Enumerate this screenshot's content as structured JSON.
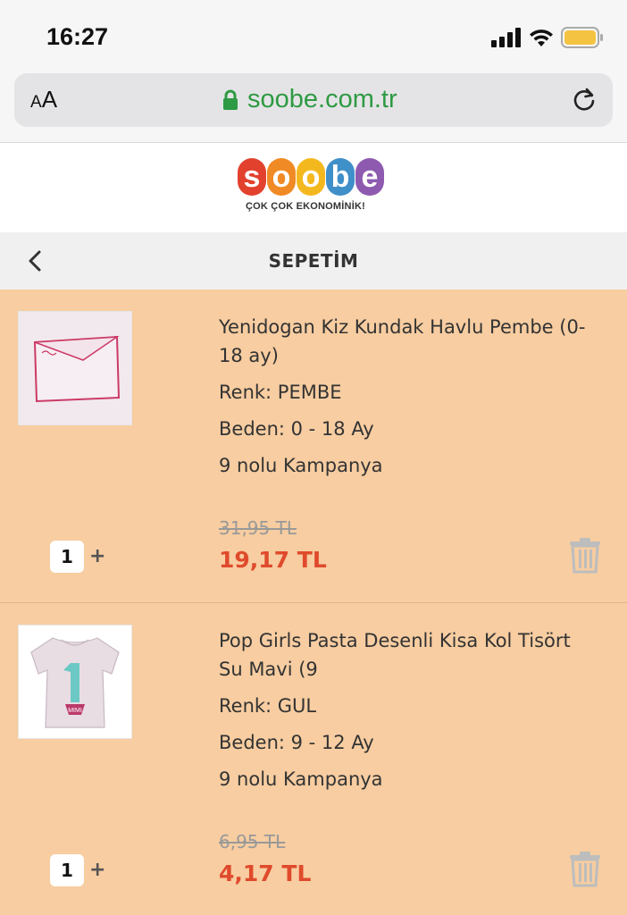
{
  "status_bar": {
    "time": "16:27"
  },
  "browser": {
    "text_size_label_small": "A",
    "text_size_label_large": "A",
    "url": "soobe.com.tr"
  },
  "logo": {
    "letters": [
      "s",
      "o",
      "o",
      "b",
      "e"
    ],
    "letter_colors": [
      "#e2412e",
      "#f08a24",
      "#f4b81f",
      "#3f8fc9",
      "#8e5ab0"
    ],
    "tagline": "ÇOK ÇOK EKONOMİNİK!"
  },
  "header": {
    "title": "SEPETİM"
  },
  "colors": {
    "cart_background": "#f7cda1",
    "price_red": "#e04a2c",
    "url_green": "#2e9a43"
  },
  "cart": {
    "items": [
      {
        "name": "Yenidogan Kiz Kundak Havlu Pembe (0-18 ay)",
        "color": "Renk: PEMBE",
        "size": "Beden: 0 - 18 Ay",
        "campaign": "9 nolu Kampanya",
        "old_price": "31,95 TL",
        "price": "19,17 TL",
        "quantity": "1",
        "plus": "+"
      },
      {
        "name": "Pop Girls Pasta Desenli Kisa Kol Tisört Su Mavi (9",
        "color": "Renk: GUL",
        "size": "Beden: 9 - 12 Ay",
        "campaign": "9 nolu Kampanya",
        "old_price": "6,95 TL",
        "price": "4,17 TL",
        "quantity": "1",
        "plus": "+"
      }
    ]
  }
}
